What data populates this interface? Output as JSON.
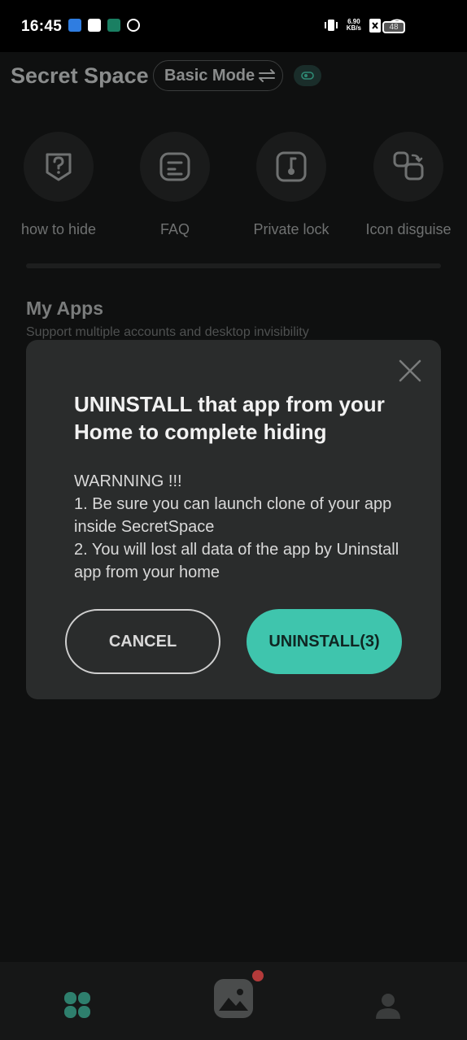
{
  "status_bar": {
    "time": "16:45",
    "net_speed_value": "6.90",
    "net_speed_unit": "KB/s",
    "battery": "48"
  },
  "header": {
    "title": "Secret Space",
    "mode_label": "Basic Mode"
  },
  "features": [
    {
      "label": "how to hide",
      "icon": "question-icon"
    },
    {
      "label": "FAQ",
      "icon": "faq-icon"
    },
    {
      "label": "Private lock",
      "icon": "lock-icon"
    },
    {
      "label": "Icon disguise",
      "icon": "disguise-icon"
    }
  ],
  "my_apps": {
    "title": "My Apps",
    "subtitle": "Support multiple accounts and desktop invisibility"
  },
  "dialog": {
    "title": "UNINSTALL that app from your Home to complete hiding",
    "body_line1": "WARNNING !!!",
    "body_line2": "1. Be sure you can launch clone of your app inside SecretSpace",
    "body_line3": "2. You will lost all data of the app by Uninstall app from your home",
    "cancel_label": "CANCEL",
    "uninstall_label": "UNINSTALL(3)"
  },
  "colors": {
    "accent": "#3fc5ad",
    "background": "#0f1010",
    "dialog": "#2a2c2c"
  }
}
